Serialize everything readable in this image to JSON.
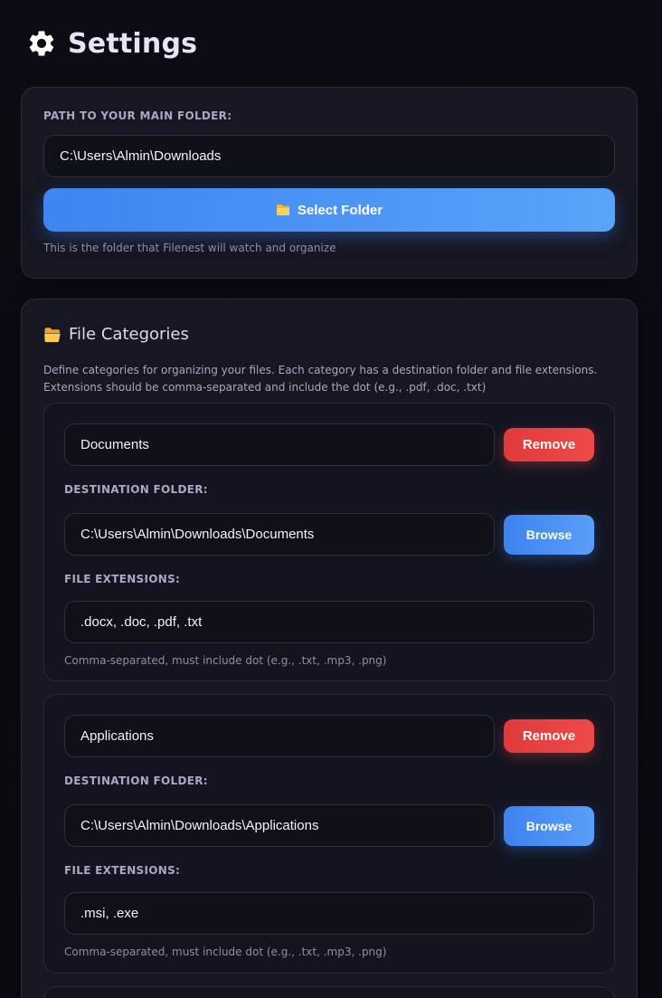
{
  "header": {
    "title": "Settings",
    "icon": "gear-icon"
  },
  "main_folder": {
    "label": "PATH TO YOUR MAIN FOLDER:",
    "value": "C:\\Users\\Almin\\Downloads",
    "select_button_label": "Select Folder",
    "select_button_icon": "folder-icon",
    "hint": "This is the folder that Filenest will watch and organize"
  },
  "categories_section": {
    "icon": "open-folder-icon",
    "title": "File Categories",
    "description": "Define categories for organizing your files. Each category has a destination folder and file extensions. Extensions should be comma-separated and include the dot (e.g., .pdf, .doc, .txt)",
    "categories": [
      {
        "name": "Documents",
        "remove_label": "Remove",
        "destination_label": "DESTINATION FOLDER:",
        "destination": "C:\\Users\\Almin\\Downloads\\Documents",
        "browse_label": "Browse",
        "extensions_label": "FILE EXTENSIONS:",
        "extensions": ".docx, .doc, .pdf, .txt",
        "extensions_hint": "Comma-separated, must include dot (e.g., .txt, .mp3, .png)"
      },
      {
        "name": "Applications",
        "remove_label": "Remove",
        "destination_label": "DESTINATION FOLDER:",
        "destination": "C:\\Users\\Almin\\Downloads\\Applications",
        "browse_label": "Browse",
        "extensions_label": "FILE EXTENSIONS:",
        "extensions": ".msi, .exe",
        "extensions_hint": "Comma-separated, must include dot (e.g., .txt, .mp3, .png)"
      }
    ]
  },
  "colors": {
    "accent_blue": "#3b82f6",
    "danger_red": "#ef4444",
    "background": "#0c0d14",
    "card": "#161722"
  }
}
